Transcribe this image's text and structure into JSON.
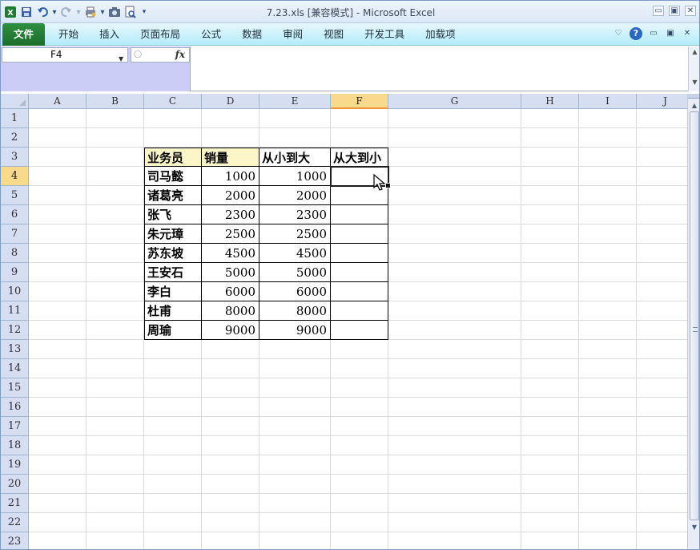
{
  "window": {
    "title": "7.23.xls  [兼容模式] - Microsoft Excel",
    "controls": {
      "minimize": "▭",
      "restore": "▣",
      "close": "✕"
    }
  },
  "qat": {
    "icons": [
      "excel-logo-icon",
      "save-icon",
      "undo-icon",
      "redo-icon",
      "quick-print-icon",
      "camera-icon",
      "print-preview-icon",
      "customize-qat-icon"
    ]
  },
  "ribbon": {
    "tabs": [
      "文件",
      "开始",
      "插入",
      "页面布局",
      "公式",
      "数据",
      "审阅",
      "视图",
      "开发工具",
      "加载项"
    ],
    "right": {
      "minimize_ribbon": "♡",
      "help": "?",
      "doc_min": "▭",
      "doc_restore": "▣",
      "doc_close": "✕"
    }
  },
  "formula_bar": {
    "name_box": "F4",
    "fx_label": "fx",
    "formula": ""
  },
  "sheet": {
    "columns": [
      "A",
      "B",
      "C",
      "D",
      "E",
      "F",
      "G",
      "H",
      "I",
      "J"
    ],
    "selected_column": "F",
    "rows": [
      "1",
      "2",
      "3",
      "4",
      "5",
      "6",
      "7",
      "8",
      "9",
      "10",
      "11",
      "12",
      "13",
      "14",
      "15",
      "16",
      "17",
      "18",
      "19",
      "20",
      "21",
      "22",
      "23"
    ],
    "selected_row": "4",
    "table": {
      "headers": [
        "业务员",
        "销量",
        "从小到大",
        "从大到小"
      ],
      "rows": [
        {
          "name": "司马懿",
          "sales": "1000",
          "asc": "1000",
          "desc": ""
        },
        {
          "name": "诸葛亮",
          "sales": "2000",
          "asc": "2000",
          "desc": ""
        },
        {
          "name": "张飞",
          "sales": "2300",
          "asc": "2300",
          "desc": ""
        },
        {
          "name": "朱元璋",
          "sales": "2500",
          "asc": "2500",
          "desc": ""
        },
        {
          "name": "苏东坡",
          "sales": "4500",
          "asc": "4500",
          "desc": ""
        },
        {
          "name": "王安石",
          "sales": "5000",
          "asc": "5000",
          "desc": ""
        },
        {
          "name": "李白",
          "sales": "6000",
          "asc": "6000",
          "desc": ""
        },
        {
          "name": "杜甫",
          "sales": "8000",
          "asc": "8000",
          "desc": ""
        },
        {
          "name": "周瑜",
          "sales": "9000",
          "asc": "9000",
          "desc": ""
        }
      ]
    }
  },
  "scrollbar": {
    "up": "▲",
    "down": "▼"
  },
  "colors": {
    "tab_file": "#1f7a32",
    "header_fill": "#fcf5c8",
    "selected_header": "#f9d98b",
    "header_bg": "#d6def2"
  }
}
